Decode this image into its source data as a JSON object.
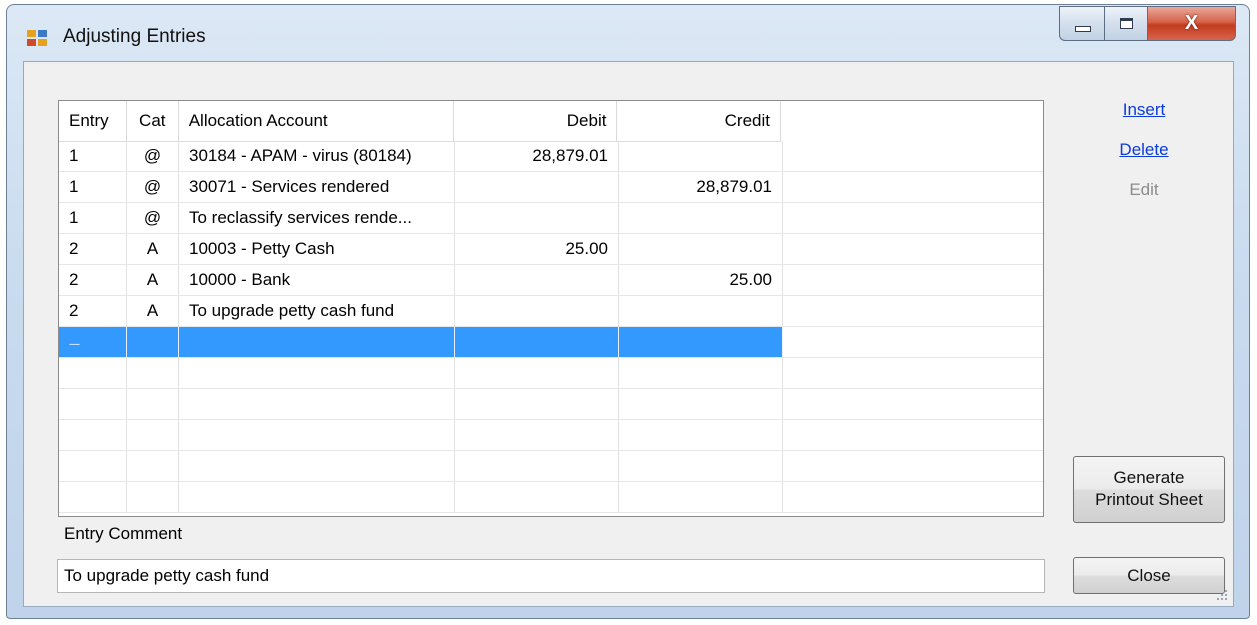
{
  "window": {
    "title": "Adjusting Entries",
    "app_icon": "app-window-icon",
    "controls": {
      "minimize": "minimize-icon",
      "maximize": "maximize-icon",
      "close": "close-icon",
      "close_glyph": "X"
    }
  },
  "grid": {
    "columns": [
      "Entry",
      "Cat",
      "Allocation Account",
      "Debit",
      "Credit"
    ],
    "rows": [
      {
        "entry": "1",
        "cat": "@",
        "account": "30184 - APAM - virus (80184)",
        "debit": "28,879.01",
        "credit": ""
      },
      {
        "entry": "1",
        "cat": "@",
        "account": "30071 - Services rendered",
        "debit": "",
        "credit": "28,879.01"
      },
      {
        "entry": "1",
        "cat": "@",
        "account": "To reclassify services rende...",
        "debit": "",
        "credit": ""
      },
      {
        "entry": "2",
        "cat": "A",
        "account": "10003 - Petty Cash",
        "debit": "25.00",
        "credit": ""
      },
      {
        "entry": "2",
        "cat": "A",
        "account": "10000 - Bank",
        "debit": "",
        "credit": "25.00"
      },
      {
        "entry": "2",
        "cat": "A",
        "account": "To upgrade petty cash fund",
        "debit": "",
        "credit": ""
      }
    ],
    "selected_row_marker": "-----",
    "selection_color": "#3399ff"
  },
  "actions": {
    "insert": "Insert",
    "delete": "Delete",
    "edit": "Edit",
    "generate_line1": "Generate",
    "generate_line2": "Printout Sheet",
    "close": "Close"
  },
  "comment": {
    "label": "Entry Comment",
    "value": "To upgrade petty cash fund"
  }
}
